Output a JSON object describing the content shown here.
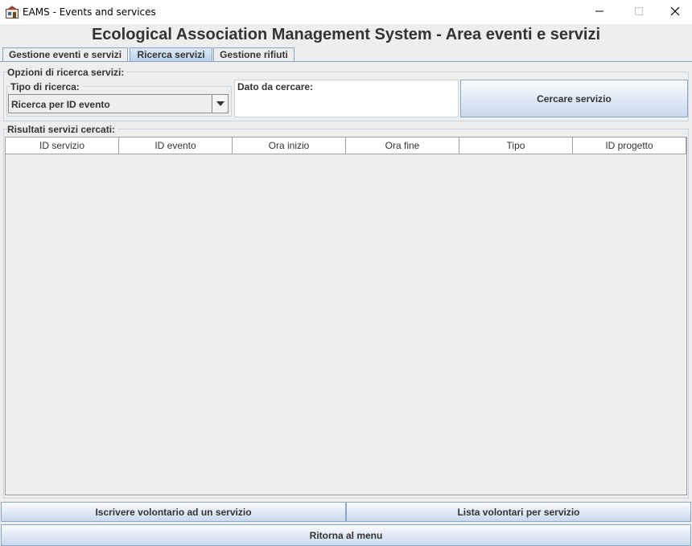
{
  "window": {
    "title": "EAMS - Events and services"
  },
  "header": {
    "title": "Ecological Association Management System - Area eventi e servizi"
  },
  "tabs": [
    {
      "label": "Gestione eventi e servizi",
      "active": false
    },
    {
      "label": "Ricerca servizi",
      "active": true
    },
    {
      "label": "Gestione rifiuti",
      "active": false
    }
  ],
  "search_options": {
    "group_label": "Opzioni di ricerca servizi:",
    "type_label": "Tipo di ricerca:",
    "type_value": "Ricerca per ID evento",
    "data_label": "Dato da cercare:",
    "data_value": "",
    "search_button": "Cercare servizio"
  },
  "results": {
    "group_label": "Risultati servizi cercati:",
    "columns": [
      "ID servizio",
      "ID evento",
      "Ora inizio",
      "Ora fine",
      "Tipo",
      "ID progetto"
    ],
    "rows": []
  },
  "actions": {
    "enroll_button": "Iscrivere volontario ad un servizio",
    "list_button": "Lista volontari per servizio",
    "back_button": "Ritorna al menu"
  },
  "colors": {
    "accent_border": "#8da5c4",
    "active_tab": "#b9d0ea",
    "background": "#eeeeee"
  },
  "icons": {
    "app": "eams-app-icon",
    "minimize": "minimize-icon",
    "maximize": "maximize-icon",
    "close": "close-icon",
    "dropdown": "chevron-down-icon"
  }
}
